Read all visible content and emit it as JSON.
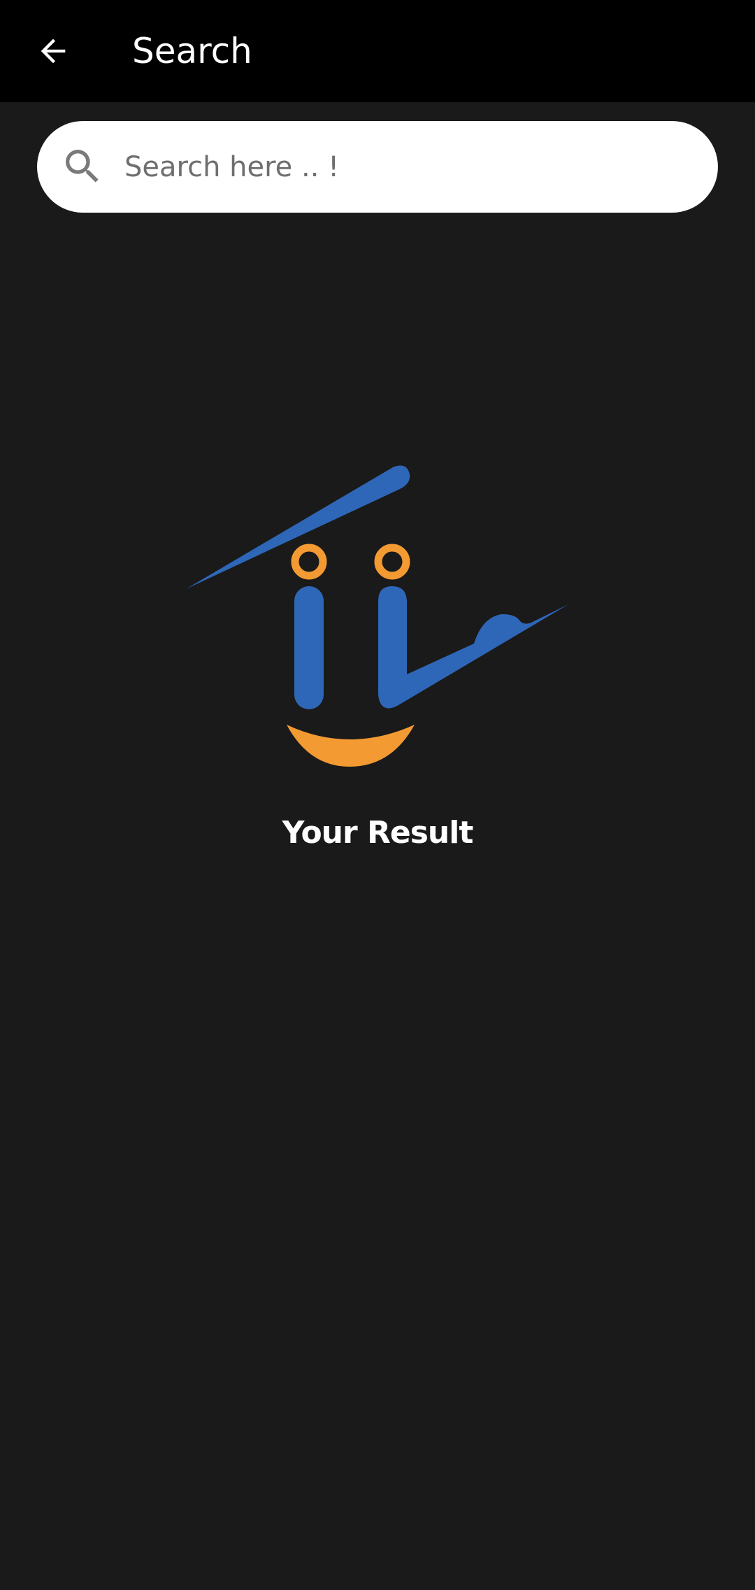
{
  "app_bar": {
    "title": "Search",
    "back_icon": "arrow-left-icon"
  },
  "search": {
    "placeholder": "Search here .. !",
    "value": "",
    "icon": "magnifier-icon"
  },
  "result": {
    "label": "Your Result"
  },
  "colors": {
    "app_bar_bg": "#000000",
    "page_bg": "#1a1a1a",
    "logo_blue": "#2f67b8",
    "logo_orange": "#f39a33",
    "text_primary": "#ffffff"
  }
}
